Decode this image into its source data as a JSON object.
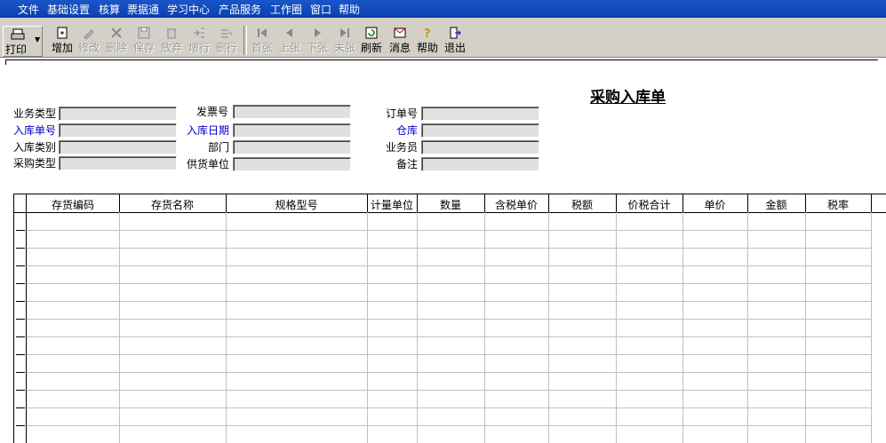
{
  "menu": [
    "文件",
    "基础设置",
    "核算",
    "票据通",
    "学习中心",
    "产品服务",
    "工作圈",
    "窗口",
    "帮助"
  ],
  "toolbar": {
    "print": "打印",
    "add": "增加",
    "edit": "修改",
    "delete": "删除",
    "save": "保存",
    "discard": "放弃",
    "add_row": "增行",
    "delete_row": "删行",
    "first": "首张",
    "prev": "上张",
    "next": "下张",
    "last": "末张",
    "refresh": "刷新",
    "message": "消息",
    "help": "帮助",
    "exit": "退出"
  },
  "document": {
    "title": "采购入库单",
    "fields": {
      "business_type": {
        "label": "业务类型",
        "value": ""
      },
      "invoice_no": {
        "label": "发票号",
        "value": ""
      },
      "order_no": {
        "label": "订单号",
        "value": ""
      },
      "receipt_no": {
        "label": "入库单号",
        "value": ""
      },
      "receipt_date": {
        "label": "入库日期",
        "value": ""
      },
      "warehouse": {
        "label": "仓库",
        "value": ""
      },
      "receipt_category": {
        "label": "入库类别",
        "value": ""
      },
      "department": {
        "label": "部门",
        "value": ""
      },
      "salesperson": {
        "label": "业务员",
        "value": ""
      },
      "purchase_type": {
        "label": "采购类型",
        "value": ""
      },
      "supplier": {
        "label": "供货单位",
        "value": ""
      },
      "remarks": {
        "label": "备注",
        "value": ""
      }
    }
  },
  "grid": {
    "columns": [
      "存货编码",
      "存货名称",
      "规格型号",
      "计量单位",
      "数量",
      "含税单价",
      "税额",
      "价税合计",
      "单价",
      "金额",
      "税率"
    ],
    "rows": 14
  },
  "colors": {
    "menubar": "#0a3fb0",
    "toolbar": "#d4d0c8",
    "required_label": "#0000c8"
  }
}
